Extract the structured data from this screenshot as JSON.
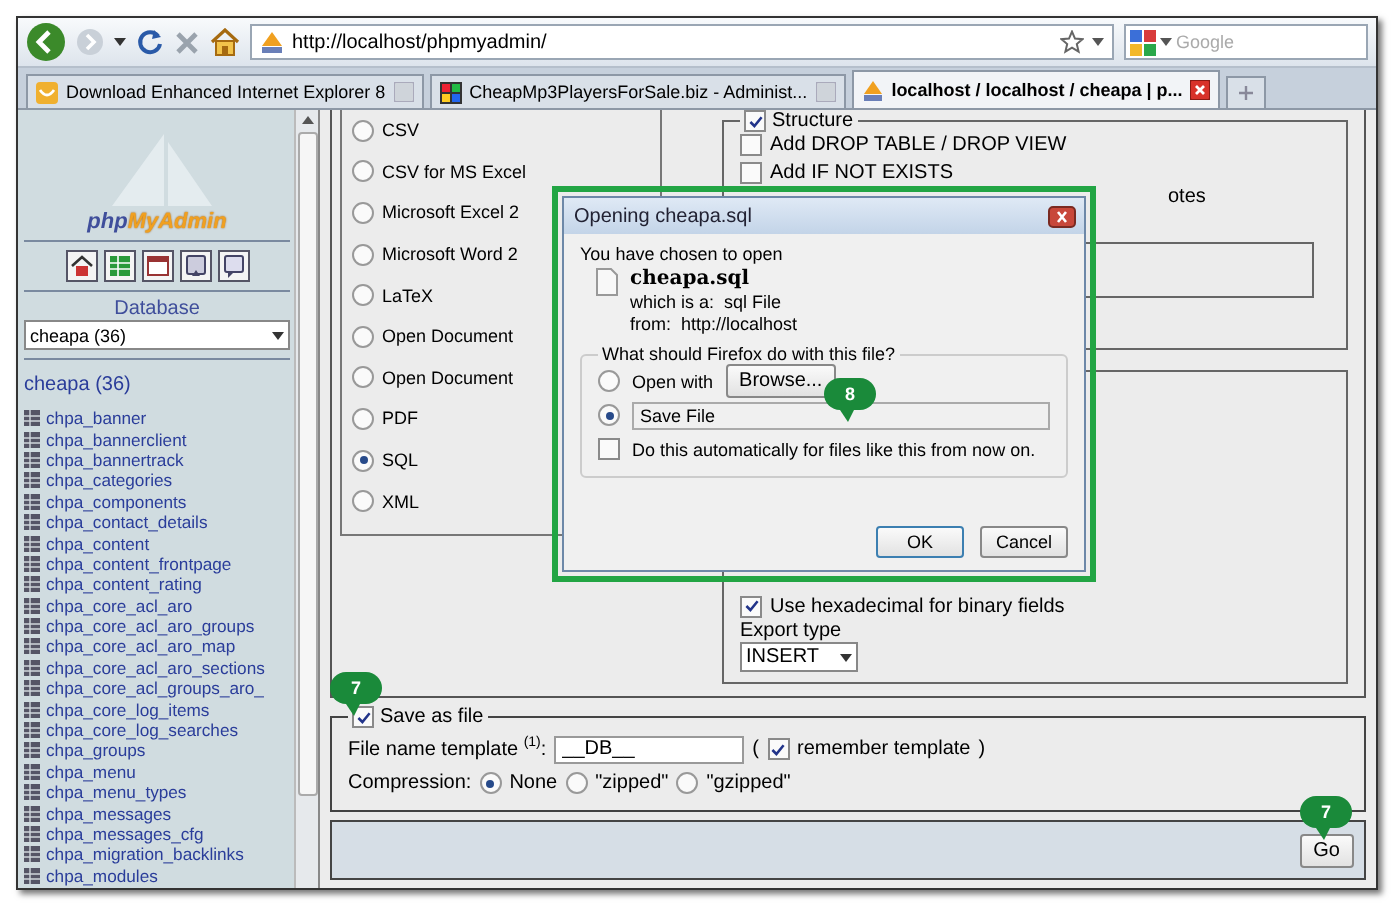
{
  "toolbar": {
    "url": "http://localhost/phpmyadmin/",
    "search_placeholder": "Google"
  },
  "tabs": [
    {
      "label": "Download Enhanced Internet Explorer 8",
      "selected": false
    },
    {
      "label": "CheapMp3PlayersForSale.biz - Administ...",
      "selected": false
    },
    {
      "label": "localhost / localhost / cheapa | p...",
      "selected": true
    }
  ],
  "sidebar": {
    "logo_prefix": "php",
    "logo_suffix": "MyAdmin",
    "database_label": "Database",
    "database_value": "cheapa (36)",
    "db_link": "cheapa (36)",
    "tables": [
      "chpa_banner",
      "chpa_bannerclient",
      "chpa_bannertrack",
      "chpa_categories",
      "chpa_components",
      "chpa_contact_details",
      "chpa_content",
      "chpa_content_frontpage",
      "chpa_content_rating",
      "chpa_core_acl_aro",
      "chpa_core_acl_aro_groups",
      "chpa_core_acl_aro_map",
      "chpa_core_acl_aro_sections",
      "chpa_core_acl_groups_aro_",
      "chpa_core_log_items",
      "chpa_core_log_searches",
      "chpa_groups",
      "chpa_menu",
      "chpa_menu_types",
      "chpa_messages",
      "chpa_messages_cfg",
      "chpa_migration_backlinks",
      "chpa_modules"
    ]
  },
  "export": {
    "formats": [
      {
        "label": "CSV",
        "selected": false
      },
      {
        "label": "CSV for MS Excel",
        "selected": false
      },
      {
        "label": "Microsoft Excel 2",
        "selected": false
      },
      {
        "label": "Microsoft Word 2",
        "selected": false
      },
      {
        "label": "LaTeX",
        "selected": false
      },
      {
        "label": "Open Document",
        "selected": false
      },
      {
        "label": "Open Document",
        "selected": false
      },
      {
        "label": "PDF",
        "selected": false
      },
      {
        "label": "SQL",
        "selected": true
      },
      {
        "label": "XML",
        "selected": false
      }
    ],
    "structure": {
      "label": "Structure",
      "checked": true
    },
    "structure_options": [
      {
        "label": "Add DROP TABLE / DROP VIEW",
        "checked": false
      },
      {
        "label": "Add IF NOT EXISTS",
        "checked": false
      }
    ],
    "structure_fragment": "otes",
    "hex_label": "Use hexadecimal for binary fields",
    "hex_checked": true,
    "export_type_label": "Export type",
    "export_type_value": "INSERT"
  },
  "save_file": {
    "label": "Save as file",
    "checked": true,
    "template_label": "File name template $^{(1)}$:",
    "template_value": "__DB__",
    "open_paren": "(",
    "remember_label": "remember template",
    "remember_checked": true,
    "close_paren": ")",
    "compression_label": "Compression:",
    "compression": [
      {
        "label": "None",
        "selected": true
      },
      {
        "label": "\"zipped\"",
        "selected": false
      },
      {
        "label": "\"gzipped\"",
        "selected": false
      }
    ]
  },
  "footer": {
    "go": "Go"
  },
  "dialog": {
    "title": "Opening cheapa.sql",
    "intro": "You have chosen to open",
    "file_name": "cheapa.sql",
    "type_label": "which is a:",
    "type_value": "sql File",
    "from_label": "from:",
    "from_value": "http://localhost",
    "question": "What should Firefox do with this file?",
    "actions": [
      {
        "label": "Open with",
        "selected": false
      },
      {
        "label": "Save File",
        "selected": true
      }
    ],
    "browse": "Browse...",
    "auto_label": "Do this automatically for files like this from now on.",
    "auto_checked": false,
    "ok": "OK",
    "cancel": "Cancel"
  },
  "callouts": [
    {
      "label": "8"
    },
    {
      "label": "7"
    },
    {
      "label": "7"
    }
  ]
}
